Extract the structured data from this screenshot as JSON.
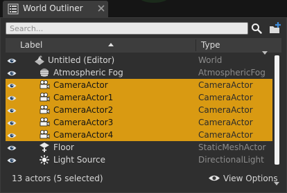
{
  "tab": {
    "title": "World Outliner",
    "icon": "list-icon",
    "close_icon": "close-icon"
  },
  "search": {
    "placeholder": "Search...",
    "value": ""
  },
  "columns": {
    "label": "Label",
    "type": "Type"
  },
  "colors": {
    "selection": "#d99a12",
    "panel": "#2f2f2f"
  },
  "rows": [
    {
      "name": "Untitled (Editor)",
      "type": "World",
      "icon": "world-icon",
      "selected": false
    },
    {
      "name": "Atmospheric Fog",
      "type": "AtmosphericFog",
      "icon": "fog-icon",
      "selected": false
    },
    {
      "name": "CameraActor",
      "type": "CameraActor",
      "icon": "camera-icon",
      "selected": true
    },
    {
      "name": "CameraActor1",
      "type": "CameraActor",
      "icon": "camera-icon",
      "selected": true
    },
    {
      "name": "CameraActor2",
      "type": "CameraActor",
      "icon": "camera-icon",
      "selected": true
    },
    {
      "name": "CameraActor3",
      "type": "CameraActor",
      "icon": "camera-icon",
      "selected": true
    },
    {
      "name": "CameraActor4",
      "type": "CameraActor",
      "icon": "camera-icon",
      "selected": true
    },
    {
      "name": "Floor",
      "type": "StaticMeshActor",
      "icon": "static-mesh-icon",
      "selected": false
    },
    {
      "name": "Light Source",
      "type": "DirectionalLight",
      "icon": "directional-light-icon",
      "selected": false
    }
  ],
  "footer": {
    "status": "13 actors (5 selected)",
    "view_options": "View Options"
  }
}
